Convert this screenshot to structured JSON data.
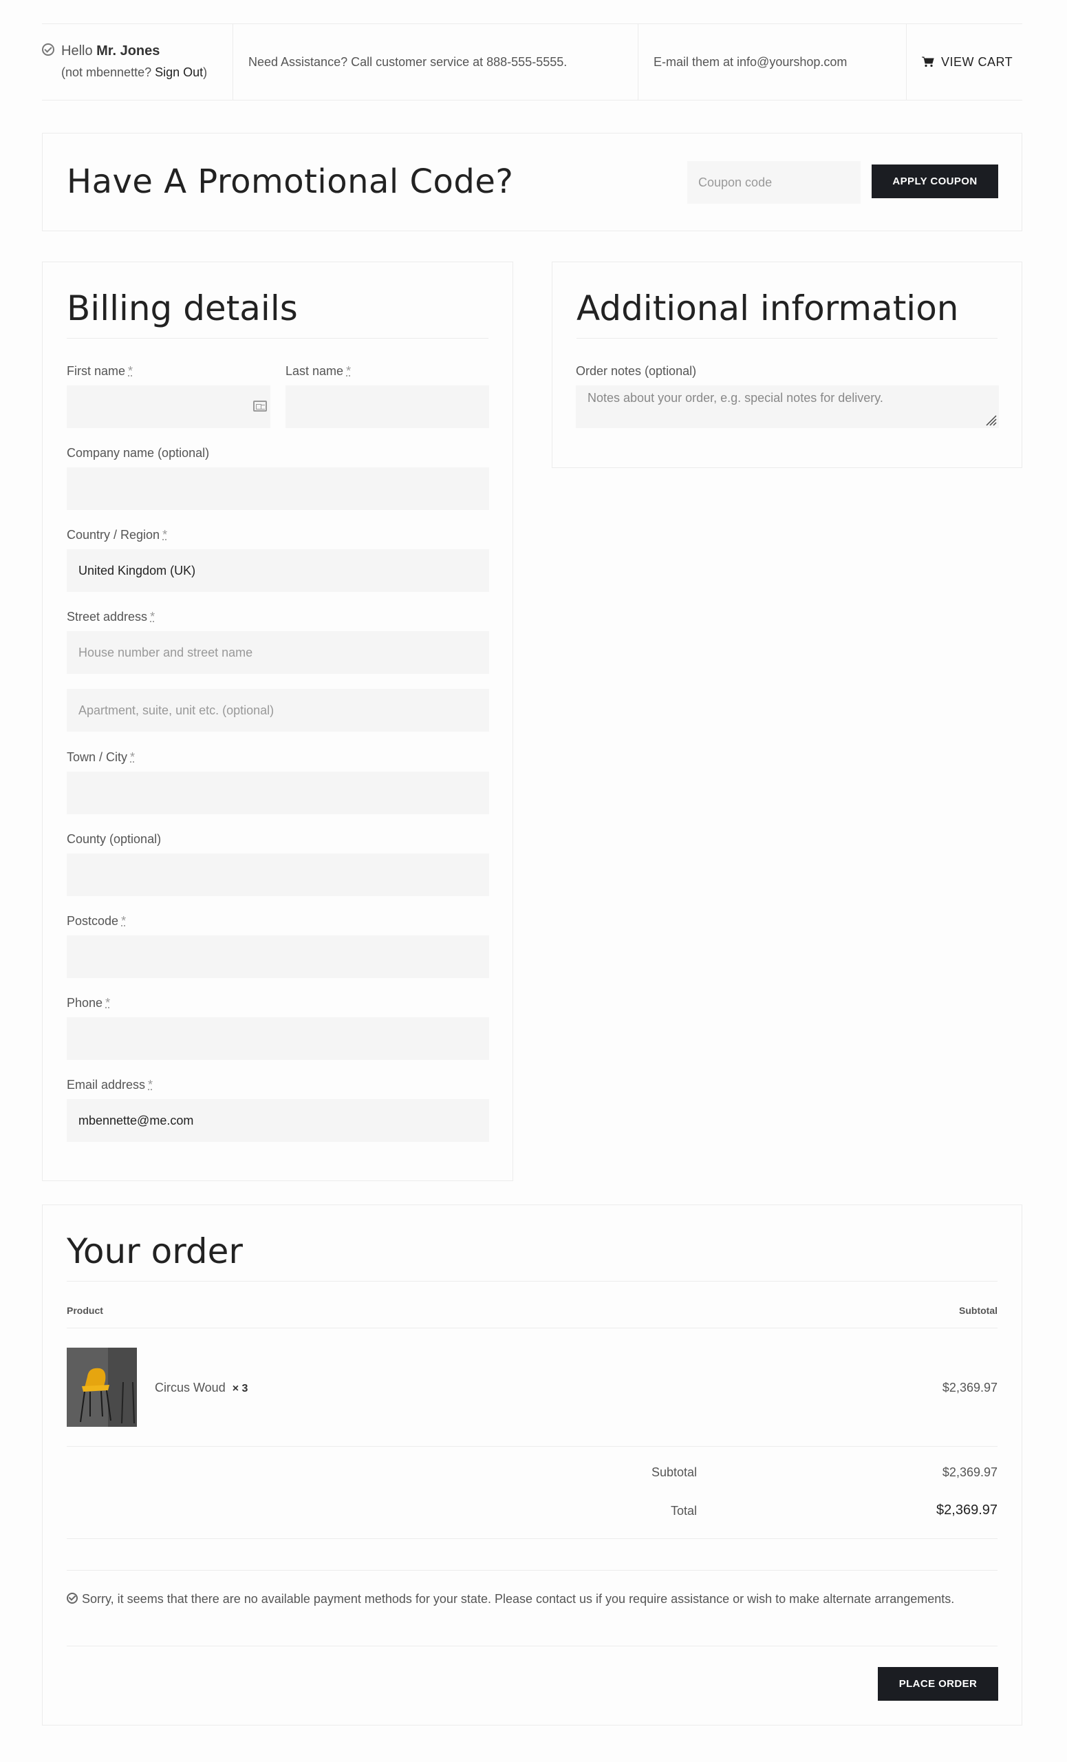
{
  "topbar": {
    "hello_prefix": "Hello",
    "user_name": "Mr. Jones",
    "not_user_prefix": "(not mbennette?",
    "sign_out": "Sign Out",
    "not_user_suffix": ")",
    "assistance": "Need Assistance? Call customer service at 888-555-5555.",
    "email": "E-mail them at info@yourshop.com",
    "view_cart": "VIEW CART"
  },
  "promo": {
    "title": "Have A Promotional Code?",
    "coupon_placeholder": "Coupon code",
    "apply_label": "APPLY COUPON"
  },
  "billing": {
    "title": "Billing details",
    "required_mark": "*",
    "fields": {
      "first_name": {
        "label": "First name",
        "value": ""
      },
      "last_name": {
        "label": "Last name",
        "value": ""
      },
      "company": {
        "label": "Company name (optional)",
        "value": ""
      },
      "country": {
        "label": "Country / Region",
        "value": "United Kingdom (UK)"
      },
      "street": {
        "label": "Street address",
        "placeholder1": "House number and street name",
        "placeholder2": "Apartment, suite, unit etc. (optional)"
      },
      "city": {
        "label": "Town / City",
        "value": ""
      },
      "county": {
        "label": "County (optional)",
        "value": ""
      },
      "postcode": {
        "label": "Postcode",
        "value": ""
      },
      "phone": {
        "label": "Phone",
        "value": ""
      },
      "email": {
        "label": "Email address",
        "value": "mbennette@me.com"
      }
    }
  },
  "additional": {
    "title": "Additional information",
    "notes_label": "Order notes (optional)",
    "notes_placeholder": "Notes about your order, e.g. special notes for delivery."
  },
  "order": {
    "title": "Your order",
    "col_product": "Product",
    "col_subtotal": "Subtotal",
    "items": [
      {
        "name": "Circus Woud",
        "qty": "× 3",
        "subtotal": "$2,369.97"
      }
    ],
    "subtotal_label": "Subtotal",
    "subtotal_value": "$2,369.97",
    "total_label": "Total",
    "total_value": "$2,369.97",
    "notice": "Sorry, it seems that there are no available payment methods for your state. Please contact us if you require assistance or wish to make alternate arrangements.",
    "place_order": "PLACE ORDER"
  }
}
